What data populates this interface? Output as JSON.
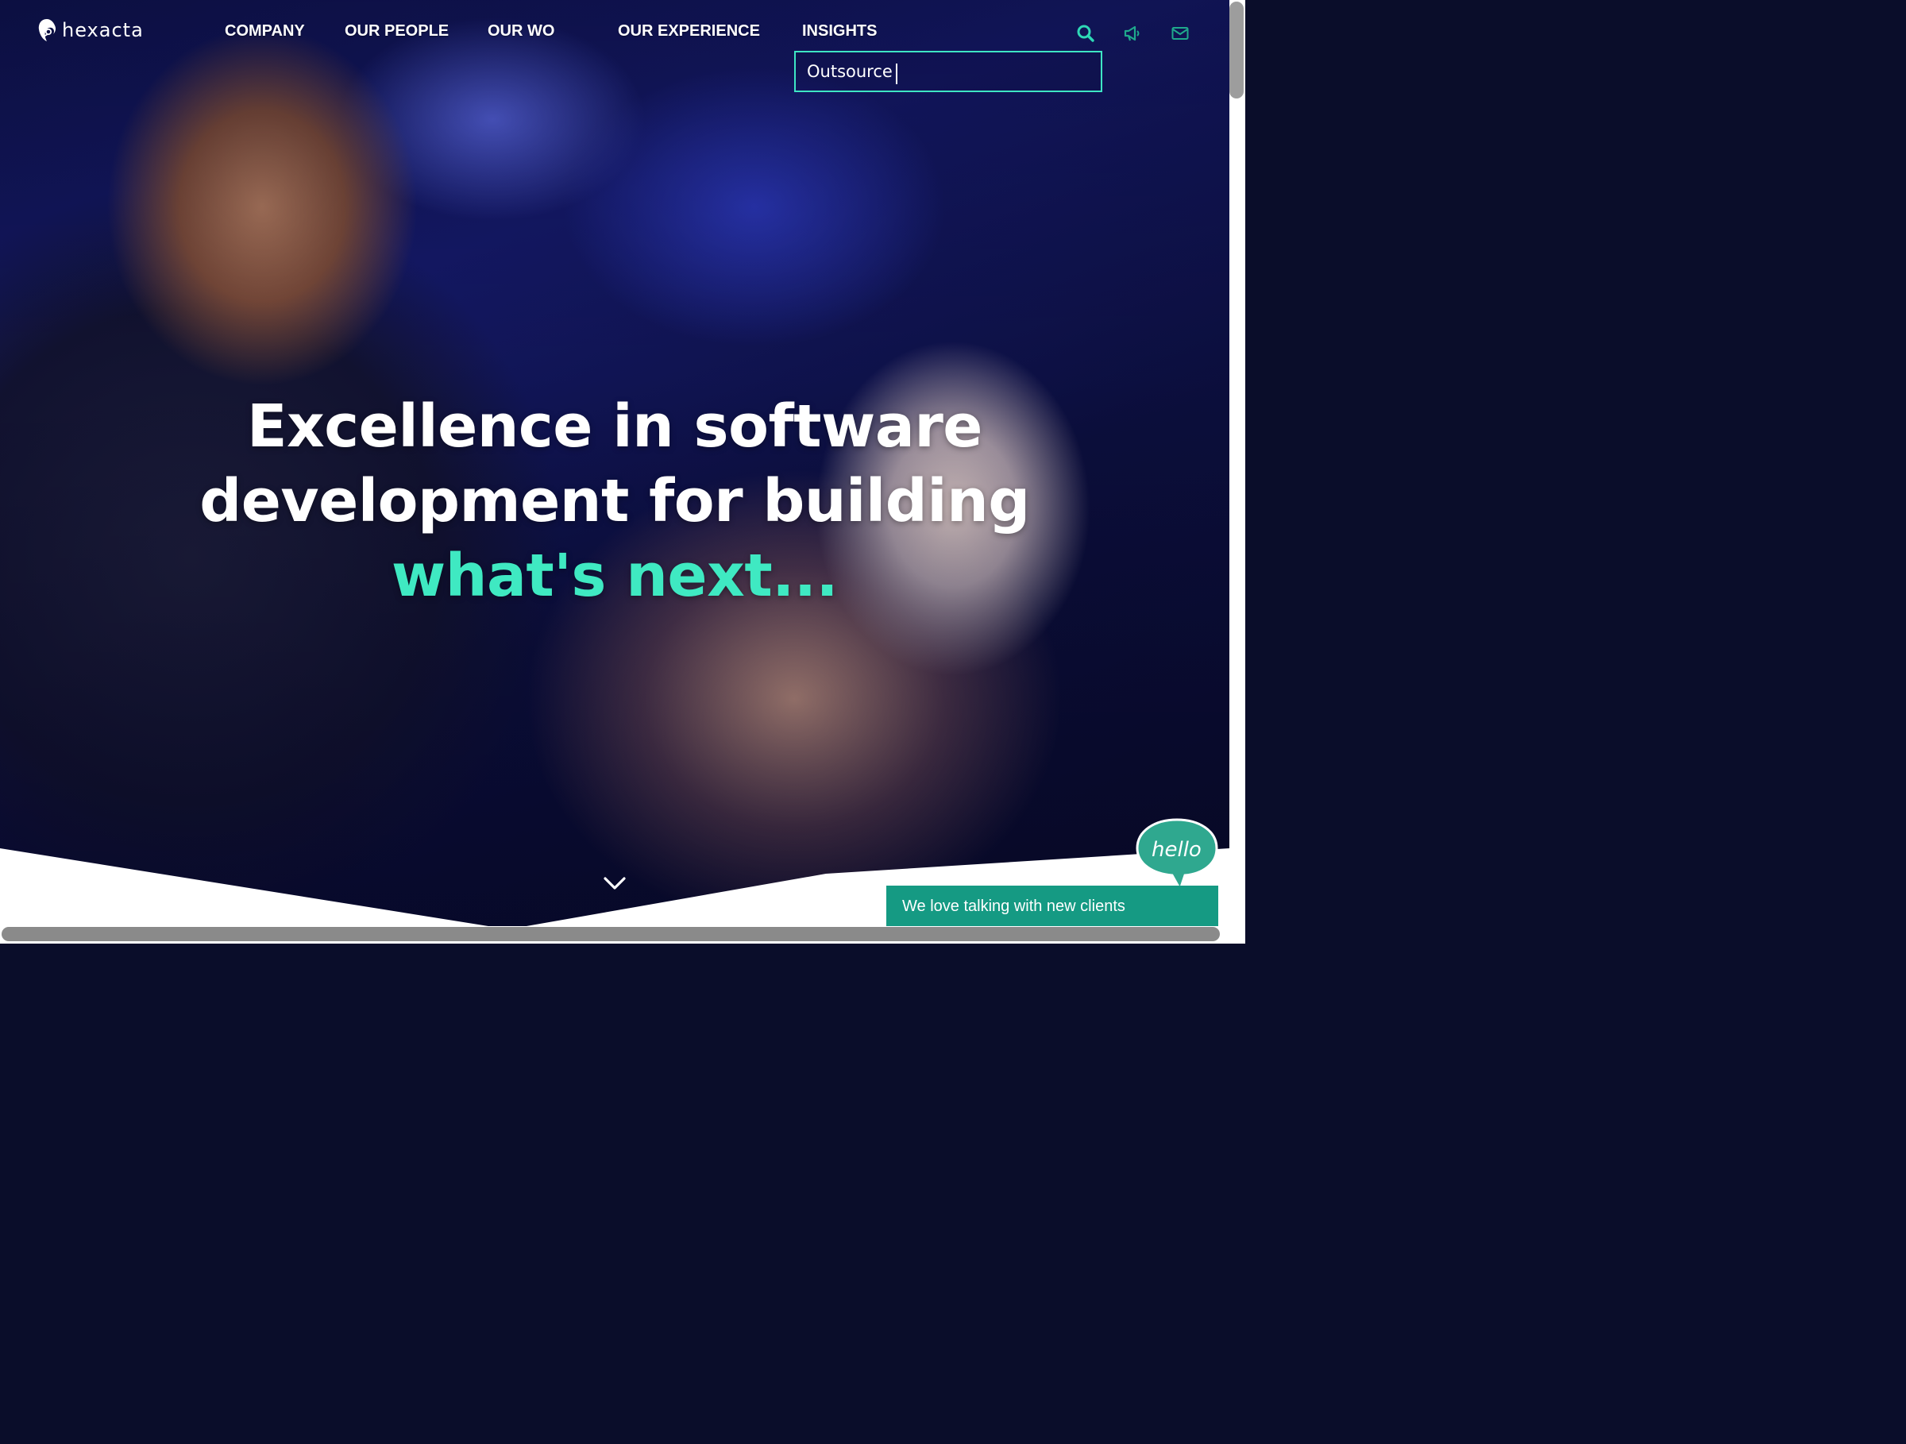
{
  "brand": {
    "logo_text": "hexacta",
    "accent_color": "#3fe9c2",
    "chat_color": "#159a83"
  },
  "nav": {
    "items": [
      {
        "label": "COMPANY"
      },
      {
        "label": "OUR PEOPLE"
      },
      {
        "label": "OUR WO"
      },
      {
        "label": "OUR EXPERIENCE"
      },
      {
        "label": "INSIGHTS"
      }
    ],
    "icons": [
      "search-icon",
      "megaphone-icon",
      "envelope-icon"
    ]
  },
  "search": {
    "value": "Outsource",
    "placeholder": ""
  },
  "hero": {
    "line1": "Excellence in software",
    "line2": "development for building",
    "line3": "what's next..."
  },
  "chat": {
    "bubble_text": "hello",
    "bar_text": "We love talking with new clients"
  }
}
